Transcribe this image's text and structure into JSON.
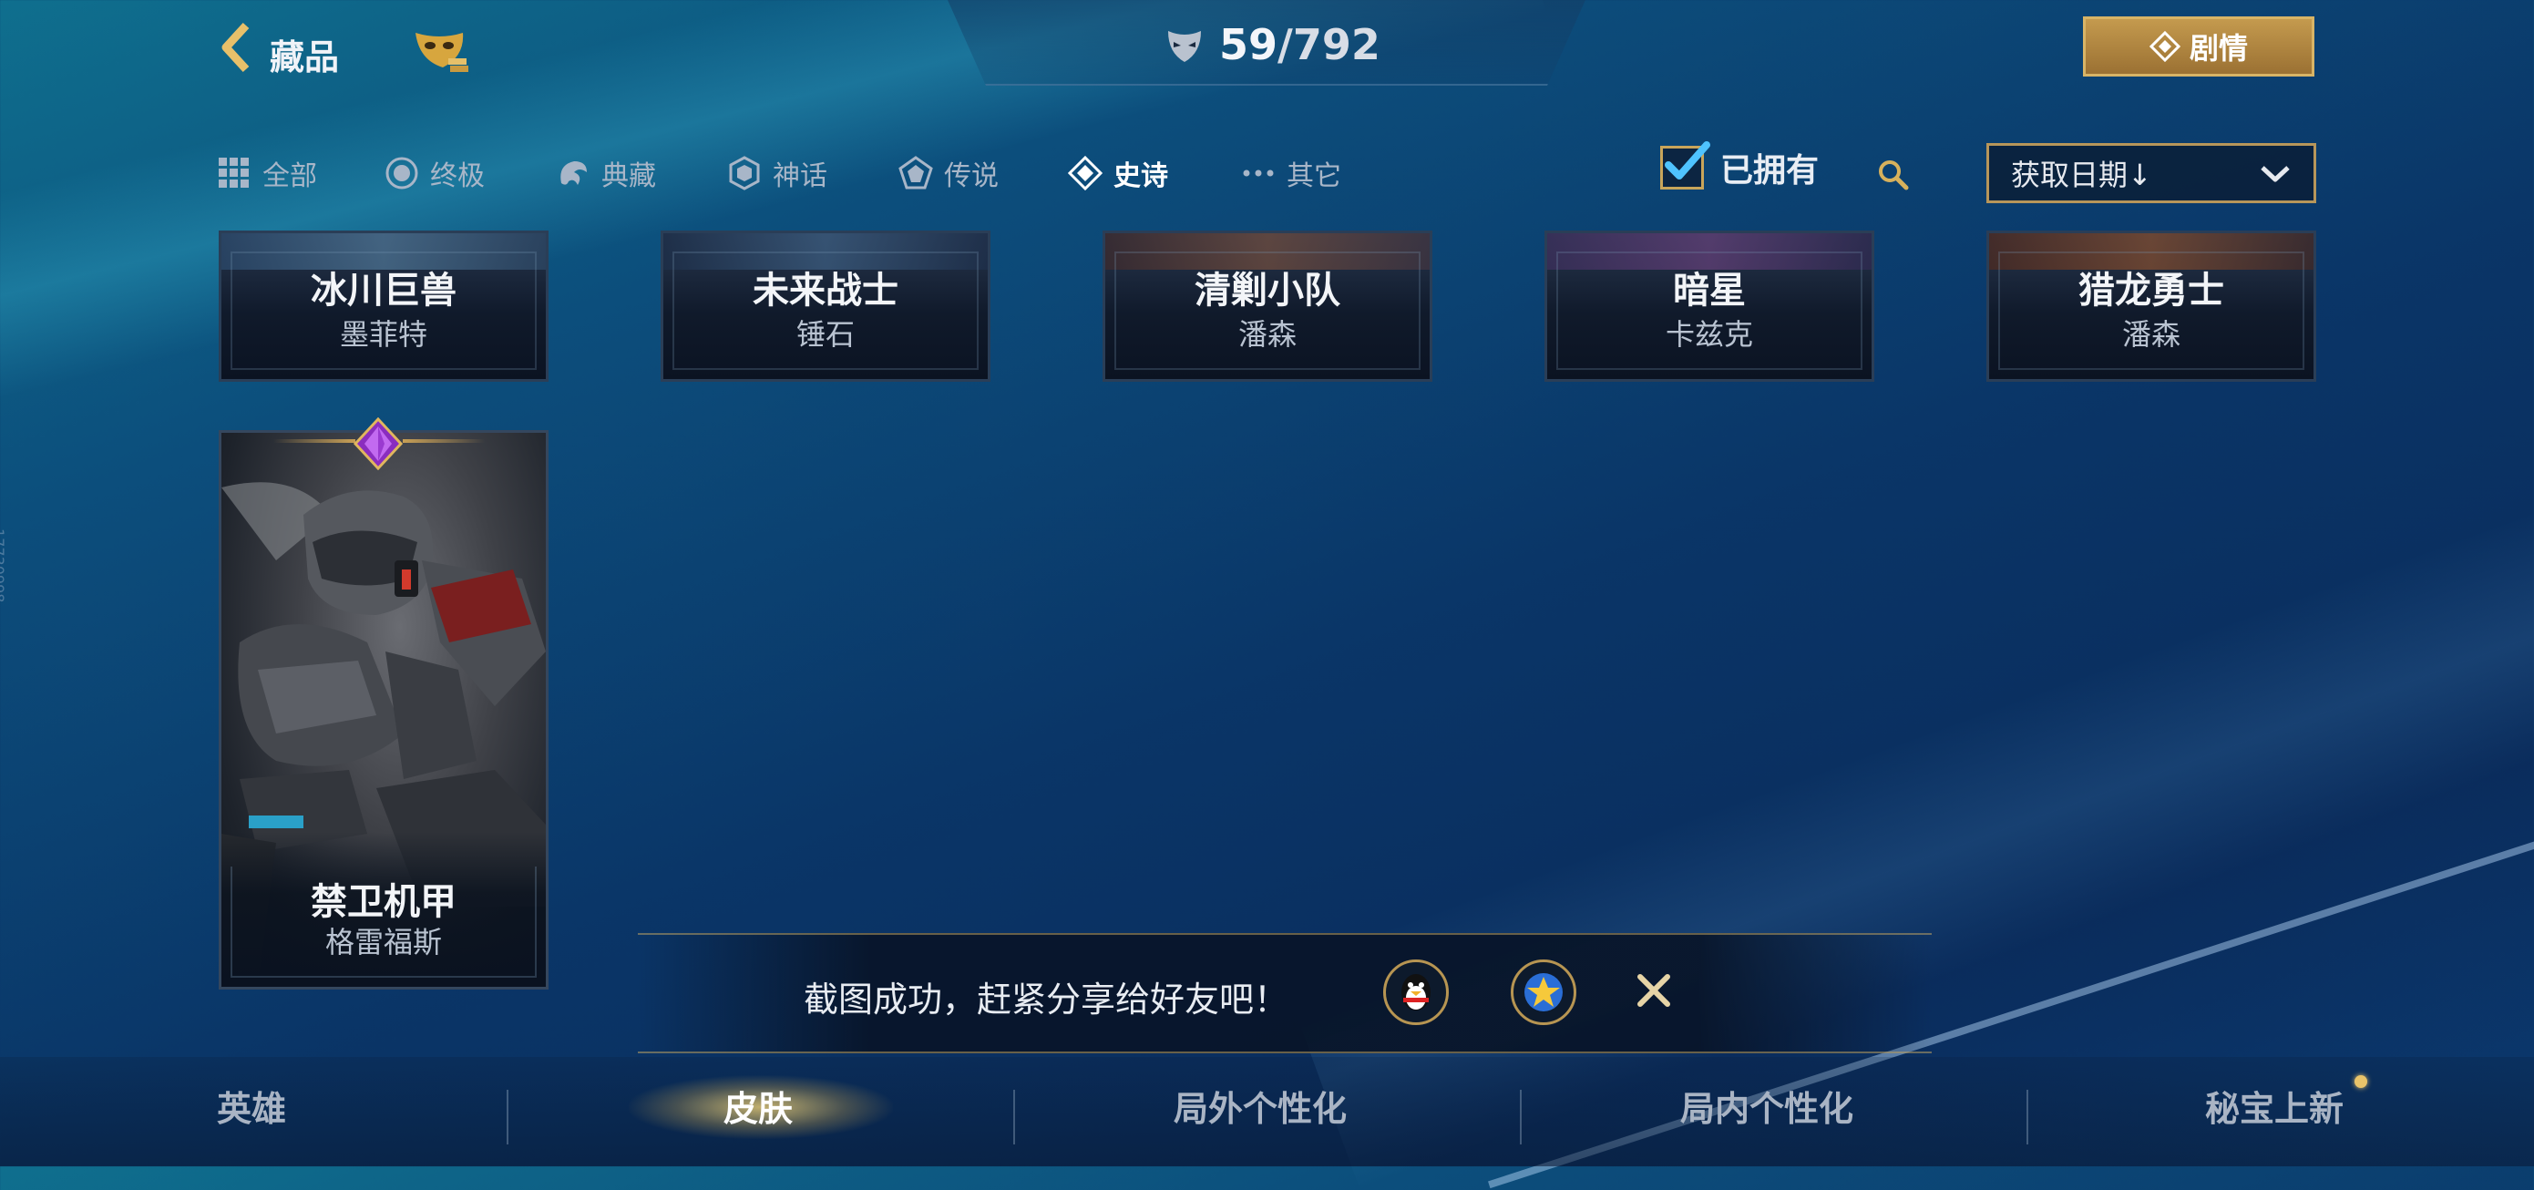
{
  "header": {
    "back_label": "藏品",
    "collection_count": "59",
    "collection_total": "/792",
    "story_button": "剧情"
  },
  "filters": [
    {
      "label": "全部",
      "icon": "grid-icon",
      "active": false
    },
    {
      "label": "终极",
      "icon": "ultimate-icon",
      "active": false
    },
    {
      "label": "典藏",
      "icon": "dragon-icon",
      "active": false
    },
    {
      "label": "神话",
      "icon": "hexagon-icon",
      "active": false
    },
    {
      "label": "传说",
      "icon": "pentagon-icon",
      "active": false
    },
    {
      "label": "史诗",
      "icon": "diamond-icon",
      "active": true
    },
    {
      "label": "其它",
      "icon": "dots-icon",
      "active": false
    }
  ],
  "owned_filter": {
    "label": "已拥有",
    "checked": true
  },
  "sort": {
    "label": "获取日期↓"
  },
  "skins": [
    {
      "name": "冰川巨兽",
      "hero": "墨菲特"
    },
    {
      "name": "未来战士",
      "hero": "锤石"
    },
    {
      "name": "清剿小队",
      "hero": "潘森"
    },
    {
      "name": "暗星",
      "hero": "卡兹克"
    },
    {
      "name": "猎龙勇士",
      "hero": "潘森"
    },
    {
      "name": "禁卫机甲",
      "hero": "格雷福斯"
    }
  ],
  "toast": {
    "message": "截图成功，赶紧分享给好友吧！"
  },
  "bottom_tabs": [
    {
      "label": "英雄",
      "active": false
    },
    {
      "label": "皮肤",
      "active": true
    },
    {
      "label": "局外个性化",
      "active": false
    },
    {
      "label": "局内个性化",
      "active": false
    },
    {
      "label": "秘宝上新",
      "active": false,
      "badge": true
    }
  ],
  "side_id": "17730998",
  "colors": {
    "gold": "#c9a55a",
    "active_tab_glow": "#ffd26e",
    "check": "#4fc3ff"
  }
}
